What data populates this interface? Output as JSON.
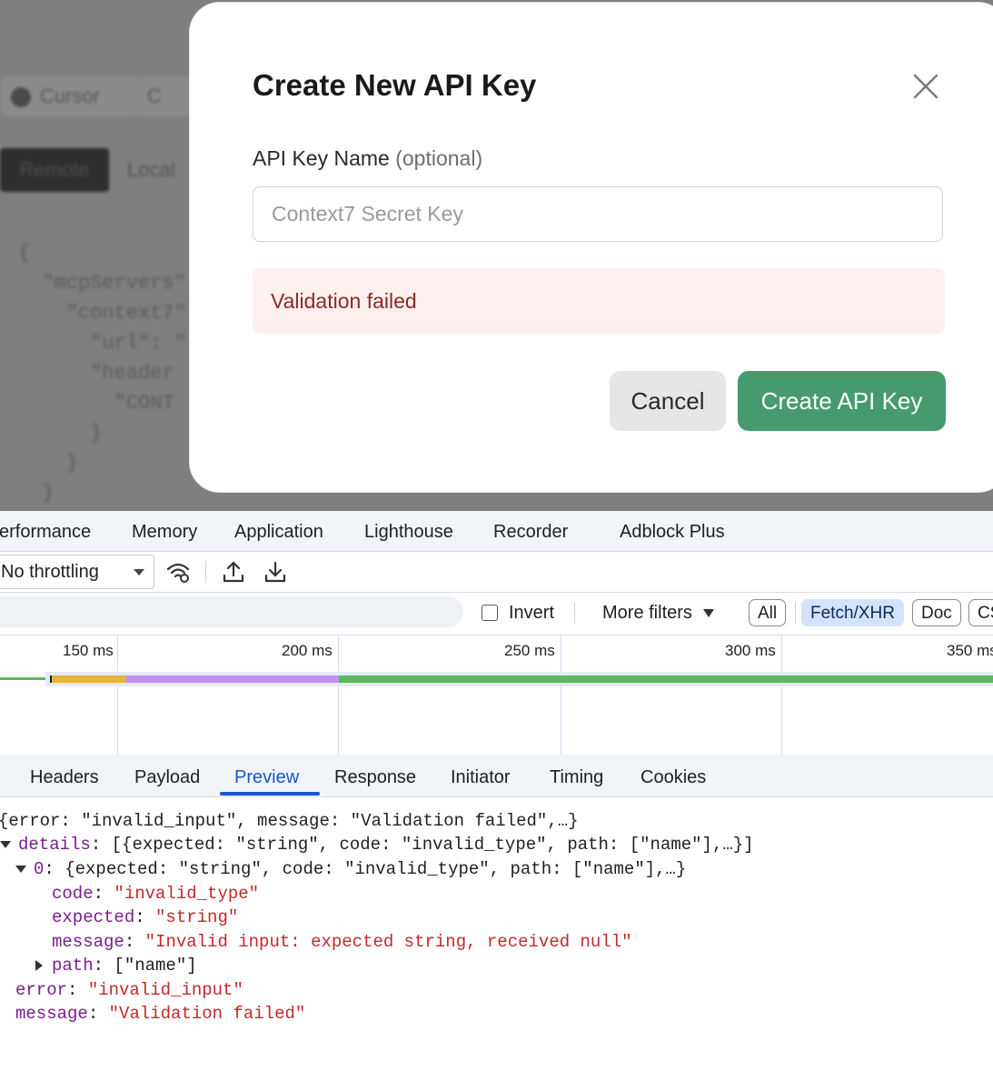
{
  "background": {
    "tabs": [
      "Cursor",
      "C"
    ],
    "segments": [
      "Remote",
      "Local"
    ],
    "code_lines": [
      "{",
      "  \"mcpServers\"",
      "    \"context7\"",
      "      \"url\": \"",
      "      \"header",
      "        \"CONT",
      "      }",
      "    }",
      "  }"
    ]
  },
  "modal": {
    "title": "Create New API Key",
    "field_label": "API Key Name",
    "field_label_optional": "(optional)",
    "input_placeholder": "Context7 Secret Key",
    "input_value": "",
    "error_message": "Validation failed",
    "cancel_label": "Cancel",
    "create_label": "Create API Key",
    "accent_color": "#469b6e"
  },
  "devtools": {
    "tabs": [
      "erformance",
      "Memory",
      "Application",
      "Lighthouse",
      "Recorder",
      "Adblock Plus"
    ],
    "throttling_value": "No throttling",
    "invert_label": "Invert",
    "more_filters_label": "More filters",
    "filter_chips": [
      {
        "label": "All",
        "active": false
      },
      {
        "label": "Fetch/XHR",
        "active": true
      },
      {
        "label": "Doc",
        "active": false
      },
      {
        "label": "CS",
        "active": false
      }
    ],
    "timeline_ticks": [
      "150 ms",
      "200 ms",
      "250 ms",
      "300 ms",
      "350 ms"
    ],
    "detail_tabs": [
      "Headers",
      "Payload",
      "Preview",
      "Response",
      "Initiator",
      "Timing",
      "Cookies"
    ],
    "active_detail_tab": "Preview",
    "preview": {
      "summary": "{error: \"invalid_input\", message: \"Validation failed\",…}",
      "details_key": "details",
      "details_summary": "[{expected: \"string\", code: \"invalid_type\", path: [\"name\"],…}]",
      "item_key": "0",
      "item_summary": "{expected: \"string\", code: \"invalid_type\", path: [\"name\"],…}",
      "code_key": "code",
      "code_value": "\"invalid_type\"",
      "expected_key": "expected",
      "expected_value": "\"string\"",
      "message_key": "message",
      "message_value": "\"Invalid input: expected string, received null\"",
      "path_key": "path",
      "path_value": "[\"name\"]",
      "error_key": "error",
      "error_value": "\"invalid_input\"",
      "top_message_key": "message",
      "top_message_value": "\"Validation failed\""
    }
  }
}
